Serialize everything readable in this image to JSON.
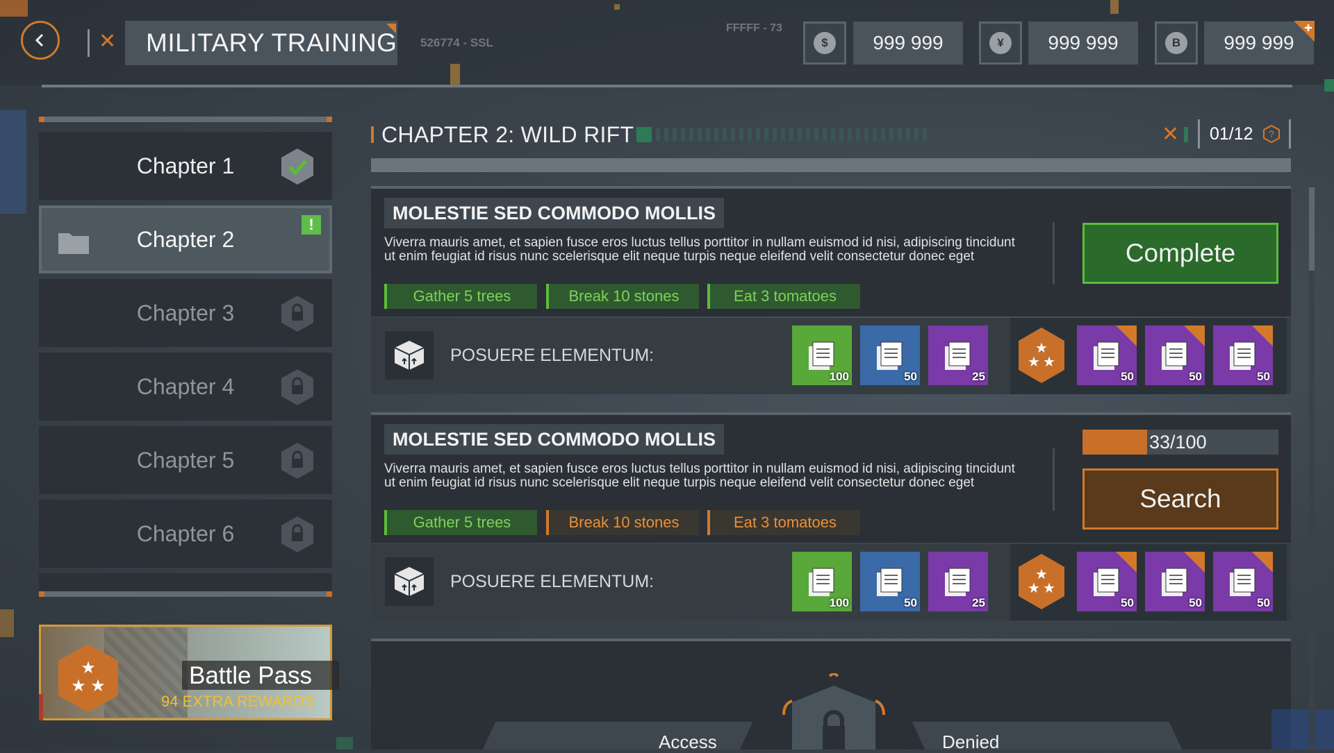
{
  "header": {
    "title": "MILITARY TRAINING",
    "build_code": "526774 - SSL",
    "hex_code": "FFFFF - 73",
    "currencies": [
      {
        "icon": "dollar-icon",
        "symbol": "$",
        "value": "999 999"
      },
      {
        "icon": "yen-icon",
        "symbol": "¥",
        "value": "999 999"
      },
      {
        "icon": "bitcoin-icon",
        "symbol": "B",
        "value": "999 999"
      }
    ]
  },
  "sidebar": {
    "chapters": [
      {
        "label": "Chapter 1",
        "state": "completed"
      },
      {
        "label": "Chapter 2",
        "state": "active"
      },
      {
        "label": "Chapter 3",
        "state": "locked"
      },
      {
        "label": "Chapter 4",
        "state": "locked"
      },
      {
        "label": "Chapter 5",
        "state": "locked"
      },
      {
        "label": "Chapter 6",
        "state": "locked"
      }
    ],
    "battle_pass": {
      "title": "Battle Pass",
      "subtitle": "94 EXTRA REWARDS"
    }
  },
  "chapter": {
    "title": "CHAPTER 2: WILD RIFT",
    "counter": "01/12"
  },
  "quests": [
    {
      "title": "MOLESTIE SED COMMODO MOLLIS",
      "description": "Viverra mauris amet, et sapien fusce eros luctus tellus porttitor in nullam euismod id nisi, adipiscing tincidunt ut enim feugiat id risus nunc scelerisque elit neque turpis neque eleifend velit consectetur donec eget",
      "tasks": [
        {
          "label": "Gather 5 trees",
          "done": true
        },
        {
          "label": "Break 10 stones",
          "done": true
        },
        {
          "label": "Eat 3 tomatoes",
          "done": true
        }
      ],
      "action_label": "Complete",
      "rewards_label": "POSUERE ELEMENTUM:",
      "rewards": [
        {
          "rarity": "green",
          "qty": "100"
        },
        {
          "rarity": "blue",
          "qty": "50"
        },
        {
          "rarity": "purple",
          "qty": "25"
        }
      ],
      "premium_rewards": [
        {
          "rarity": "purple",
          "qty": "50",
          "locked": true
        },
        {
          "rarity": "purple",
          "qty": "50",
          "locked": true
        },
        {
          "rarity": "purple",
          "qty": "50",
          "locked": true
        }
      ]
    },
    {
      "title": "MOLESTIE SED COMMODO MOLLIS",
      "description": "Viverra mauris amet, et sapien fusce eros luctus tellus porttitor in nullam euismod id nisi, adipiscing tincidunt ut enim feugiat id risus nunc scelerisque elit neque turpis neque eleifend velit consectetur donec eget",
      "tasks": [
        {
          "label": "Gather 5 trees",
          "done": true
        },
        {
          "label": "Break 10 stones",
          "done": false
        },
        {
          "label": "Eat 3 tomatoes",
          "done": false
        }
      ],
      "progress": {
        "text": "33/100",
        "value": 33,
        "max": 100
      },
      "action_label": "Search",
      "rewards_label": "POSUERE ELEMENTUM:",
      "rewards": [
        {
          "rarity": "green",
          "qty": "100"
        },
        {
          "rarity": "blue",
          "qty": "50"
        },
        {
          "rarity": "purple",
          "qty": "25"
        }
      ],
      "premium_rewards": [
        {
          "rarity": "purple",
          "qty": "50",
          "locked": true
        },
        {
          "rarity": "purple",
          "qty": "50",
          "locked": true
        },
        {
          "rarity": "purple",
          "qty": "50",
          "locked": true
        }
      ]
    }
  ],
  "locked_section": {
    "left_label": "Access",
    "right_label": "Denied"
  },
  "colors": {
    "accent": "#d27a2a",
    "success": "#5cbd3a",
    "panel": "#2a3035"
  }
}
